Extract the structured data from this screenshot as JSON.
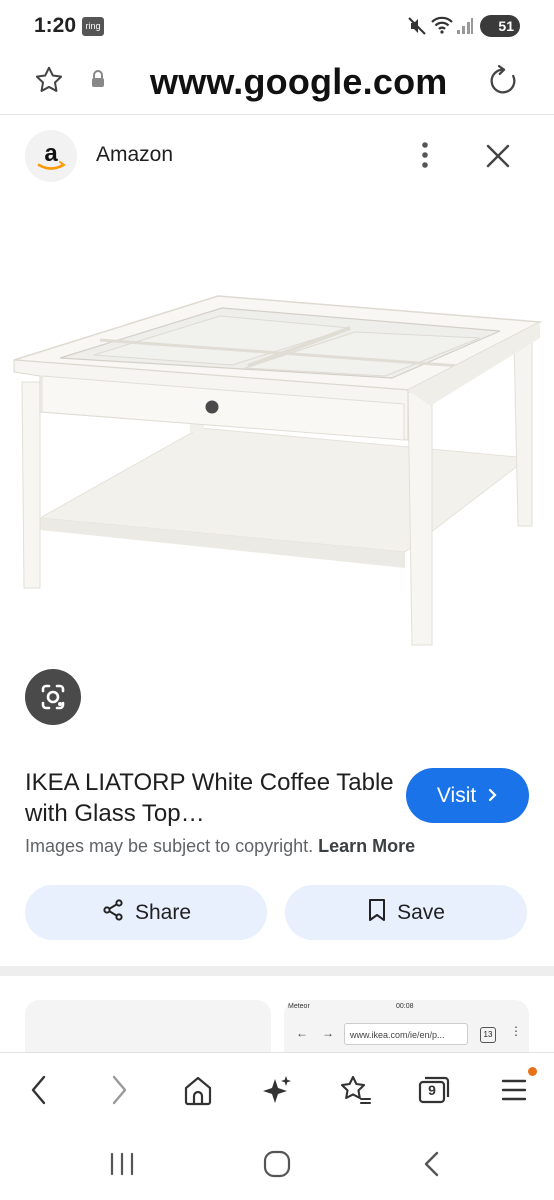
{
  "status_bar": {
    "time": "1:20",
    "notification_badge": "ring",
    "battery_level": "51"
  },
  "url_bar": {
    "url": "www.google.com"
  },
  "source": {
    "name": "Amazon"
  },
  "product": {
    "title": "IKEA LIATORP White Coffee Table with Glass Top…",
    "visit_label": "Visit",
    "copyright_text": "Images may be subject to copyright.",
    "learn_more_label": "Learn More"
  },
  "actions": {
    "share_label": "Share",
    "save_label": "Save"
  },
  "related": {
    "preview_status": "Meteor",
    "preview_time": "00:08",
    "preview_url": "www.ikea.com/ie/en/p...",
    "preview_tabs": "13"
  },
  "toolbar": {
    "tab_count": "9"
  },
  "colors": {
    "accent": "#1a73e8",
    "pill_bg": "#e8f0fe",
    "notify_dot": "#e8711a"
  }
}
